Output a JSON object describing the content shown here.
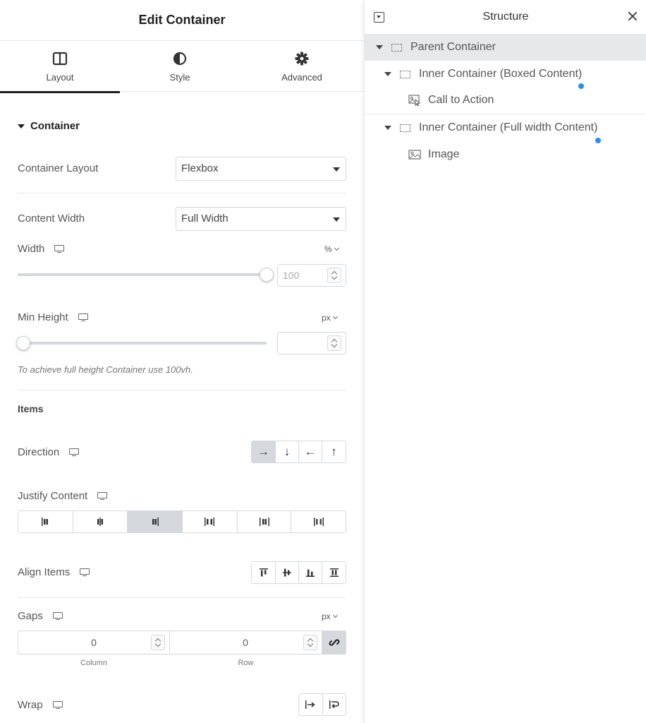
{
  "editor": {
    "title": "Edit Container",
    "tabs": [
      {
        "label": "Layout",
        "icon": "columns-icon",
        "active": true
      },
      {
        "label": "Style",
        "icon": "half-circle-icon",
        "active": false
      },
      {
        "label": "Advanced",
        "icon": "gear-icon",
        "active": false
      }
    ],
    "section": "Container",
    "container_layout": {
      "label": "Container Layout",
      "value": "Flexbox"
    },
    "content_width": {
      "label": "Content Width",
      "value": "Full Width"
    },
    "width": {
      "label": "Width",
      "unit": "%",
      "value": "100",
      "slider_value": 100
    },
    "min_height": {
      "label": "Min Height",
      "unit": "px",
      "value": "",
      "slider_value": 0
    },
    "hint": "To achieve full height Container use 100vh.",
    "items_heading": "Items",
    "direction": {
      "label": "Direction",
      "options": [
        "→",
        "↓",
        "←",
        "↑"
      ],
      "selected": 0
    },
    "justify": {
      "label": "Justify Content",
      "selected": 2
    },
    "align": {
      "label": "Align Items"
    },
    "gaps": {
      "label": "Gaps",
      "unit": "px",
      "column_value": "0",
      "row_value": "0",
      "column_label": "Column",
      "row_label": "Row"
    },
    "wrap": {
      "label": "Wrap"
    }
  },
  "structure": {
    "title": "Structure",
    "nodes": [
      {
        "label": "Parent Container",
        "level": 0,
        "selected": true
      },
      {
        "label": "Inner Container (Boxed Content)",
        "level": 1
      },
      {
        "label": "Call to Action",
        "level": 2
      },
      {
        "label": "Inner Container (Full width Content)",
        "level": 1
      },
      {
        "label": "Image",
        "level": 2
      }
    ]
  },
  "colors": {
    "accent_dot": "#2a8bf2",
    "active_bg": "#d5d8dc"
  }
}
